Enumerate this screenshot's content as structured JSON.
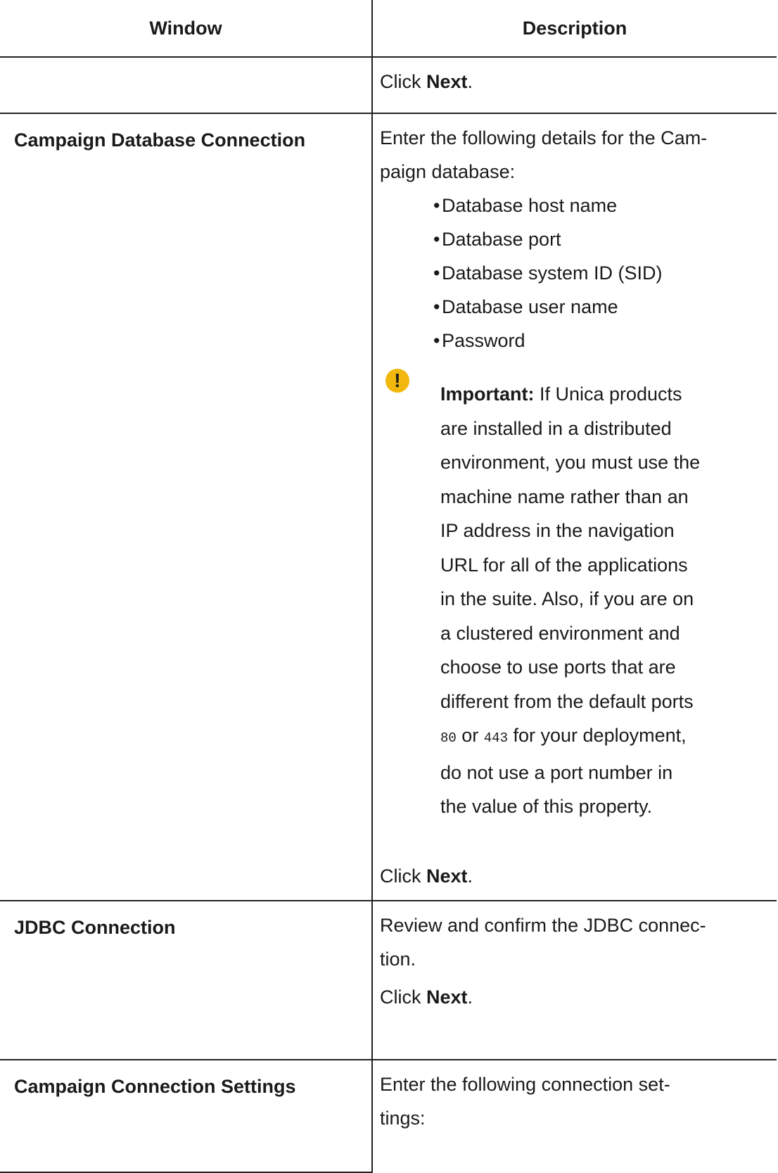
{
  "table": {
    "headers": {
      "window": "Window",
      "description": "Description"
    },
    "row0": {
      "window": "",
      "click_prefix": "Click ",
      "click_bold": "Next",
      "click_suffix": "."
    },
    "row1": {
      "window": "Campaign Database Connection",
      "intro_line1": "Enter the following details for the Cam-",
      "intro_line2": "paign database:",
      "bullets": [
        "Database host name",
        "Database port",
        "Database system ID (SID)",
        "Database user name",
        "Password"
      ],
      "note_icon": "!",
      "note_label": "Important:",
      "note_lines": [
        " If Unica products",
        "are installed in a distributed",
        "environment, you must use the",
        "machine name rather than an",
        "IP address in the navigation",
        "URL for all of the applications",
        "in the suite. Also, if you are on",
        "a clustered environment and",
        "choose to use ports that are",
        "different from the default ports"
      ],
      "note_port1": "80",
      "note_or": " or ",
      "note_port2": "443",
      "note_line_end": " for your deployment,",
      "note_tail_lines": [
        "do not use a port number in",
        "the value of this property."
      ],
      "click_prefix": "Click ",
      "click_bold": "Next",
      "click_suffix": "."
    },
    "row2": {
      "window": "JDBC Connection",
      "line1": "Review and confirm the JDBC connec-",
      "line2": "tion.",
      "click_prefix": "Click ",
      "click_bold": "Next",
      "click_suffix": "."
    },
    "row3": {
      "window": "Campaign Connection Settings",
      "line1": "Enter the following connection set-",
      "line2": "tings:"
    }
  },
  "colors": {
    "note_icon": "#f2b70c",
    "border": "#222222"
  }
}
